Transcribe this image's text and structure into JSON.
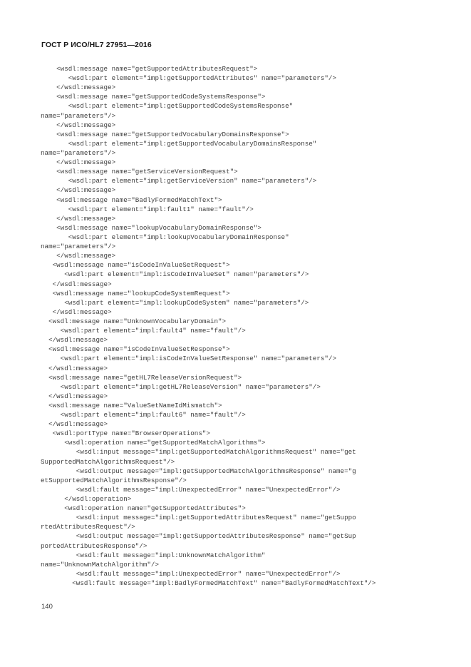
{
  "document": {
    "standard_header": "ГОСТ Р ИСО/HL7 27951—2016",
    "page_number": "140",
    "colors": {
      "page_background": "#ffffff",
      "header_text": "#1a1a1a",
      "code_text": "#3d3d3d",
      "page_number_text": "#3a3a3a"
    }
  },
  "code": {
    "language": "wsdl-xml",
    "lines": [
      "    <wsdl:message name=\"getSupportedAttributesRequest\">",
      "       <wsdl:part element=\"impl:getSupportedAttributes\" name=\"parameters\"/>",
      "    </wsdl:message>",
      "    <wsdl:message name=\"getSupportedCodeSystemsResponse\">",
      "       <wsdl:part element=\"impl:getSupportedCodeSystemsResponse\"",
      "name=\"parameters\"/>",
      "    </wsdl:message>",
      "    <wsdl:message name=\"getSupportedVocabularyDomainsResponse\">",
      "       <wsdl:part element=\"impl:getSupportedVocabularyDomainsResponse\"",
      "name=\"parameters\"/>",
      "    </wsdl:message>",
      "    <wsdl:message name=\"getServiceVersionRequest\">",
      "       <wsdl:part element=\"impl:getServiceVersion\" name=\"parameters\"/>",
      "    </wsdl:message>",
      "    <wsdl:message name=\"BadlyFormedMatchText\">",
      "       <wsdl:part element=\"impl:fault1\" name=\"fault\"/>",
      "    </wsdl:message>",
      "    <wsdl:message name=\"lookupVocabularyDomainResponse\">",
      "       <wsdl:part element=\"impl:lookupVocabularyDomainResponse\"",
      "name=\"parameters\"/>",
      "    </wsdl:message>",
      "   <wsdl:message name=\"isCodeInValueSetRequest\">",
      "      <wsdl:part element=\"impl:isCodeInValueSet\" name=\"parameters\"/>",
      "   </wsdl:message>",
      "   <wsdl:message name=\"lookupCodeSystemRequest\">",
      "      <wsdl:part element=\"impl:lookupCodeSystem\" name=\"parameters\"/>",
      "   </wsdl:message>",
      "  <wsdl:message name=\"UnknownVocabularyDomain\">",
      "     <wsdl:part element=\"impl:fault4\" name=\"fault\"/>",
      "  </wsdl:message>",
      "  <wsdl:message name=\"isCodeInValueSetResponse\">",
      "     <wsdl:part element=\"impl:isCodeInValueSetResponse\" name=\"parameters\"/>",
      "  </wsdl:message>",
      "  <wsdl:message name=\"getHL7ReleaseVersionRequest\">",
      "     <wsdl:part element=\"impl:getHL7ReleaseVersion\" name=\"parameters\"/>",
      "  </wsdl:message>",
      "  <wsdl:message name=\"ValueSetNameIdMismatch\">",
      "     <wsdl:part element=\"impl:fault6\" name=\"fault\"/>",
      "  </wsdl:message>",
      "   <wsdl:portType name=\"BrowserOperations\">",
      "      <wsdl:operation name=\"getSupportedMatchAlgorithms\">",
      "         <wsdl:input message=\"impl:getSupportedMatchAlgorithmsRequest\" name=\"get",
      "SupportedMatchAlgorithmsRequest\"/>",
      "         <wsdl:output message=\"impl:getSupportedMatchAlgorithmsResponse\" name=\"g",
      "etSupportedMatchAlgorithmsResponse\"/>",
      "         <wsdl:fault message=\"impl:UnexpectedError\" name=\"UnexpectedError\"/>",
      "      </wsdl:operation>",
      "      <wsdl:operation name=\"getSupportedAttributes\">",
      "         <wsdl:input message=\"impl:getSupportedAttributesRequest\" name=\"getSuppo",
      "rtedAttributesRequest\"/>",
      "         <wsdl:output message=\"impl:getSupportedAttributesResponse\" name=\"getSup",
      "portedAttributesResponse\"/>",
      "         <wsdl:fault message=\"impl:UnknownMatchAlgorithm\"",
      "name=\"UnknownMatchAlgorithm\"/>",
      "         <wsdl:fault message=\"impl:UnexpectedError\" name=\"UnexpectedError\"/>",
      "        <wsdl:fault message=\"impl:BadlyFormedMatchText\" name=\"BadlyFormedMatchText\"/>"
    ]
  }
}
